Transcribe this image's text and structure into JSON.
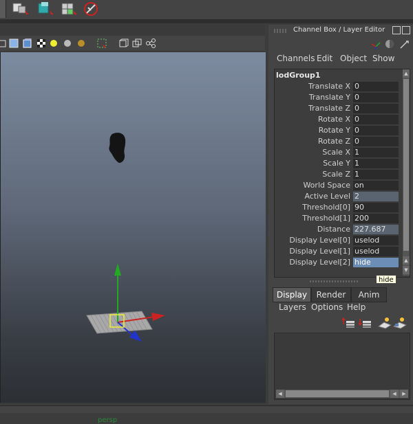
{
  "channel_box": {
    "title": "Channel Box / Layer Editor",
    "menu": [
      "Channels",
      "Edit",
      "Object",
      "Show"
    ],
    "node_name": "lodGroup1",
    "attributes": [
      {
        "label": "Translate X",
        "value": "0"
      },
      {
        "label": "Translate Y",
        "value": "0"
      },
      {
        "label": "Translate Z",
        "value": "0"
      },
      {
        "label": "Rotate X",
        "value": "0"
      },
      {
        "label": "Rotate Y",
        "value": "0"
      },
      {
        "label": "Rotate Z",
        "value": "0"
      },
      {
        "label": "Scale X",
        "value": "1"
      },
      {
        "label": "Scale Y",
        "value": "1"
      },
      {
        "label": "Scale Z",
        "value": "1"
      },
      {
        "label": "World Space",
        "value": "on"
      },
      {
        "label": "Active Level",
        "value": "2"
      },
      {
        "label": "Threshold[0]",
        "value": "90"
      },
      {
        "label": "Threshold[1]",
        "value": "200"
      },
      {
        "label": "Distance",
        "value": "227.687"
      },
      {
        "label": "Display Level[0]",
        "value": "uselod"
      },
      {
        "label": "Display Level[1]",
        "value": "uselod"
      },
      {
        "label": "Display Level[2]",
        "value": "hide"
      }
    ],
    "tooltip": "hide"
  },
  "layer_editor": {
    "tabs": [
      "Display",
      "Render",
      "Anim"
    ],
    "active_tab": "Display",
    "menu": [
      "Layers",
      "Options",
      "Help"
    ]
  },
  "viewport": {
    "camera_label": "persp"
  },
  "colors": {
    "panel_bg": "#444444",
    "selected_field": "#6c8db5",
    "axis_x": "#cc2222",
    "axis_y": "#22aa22",
    "axis_z": "#2233cc",
    "camera_label": "#2a8a3a"
  }
}
